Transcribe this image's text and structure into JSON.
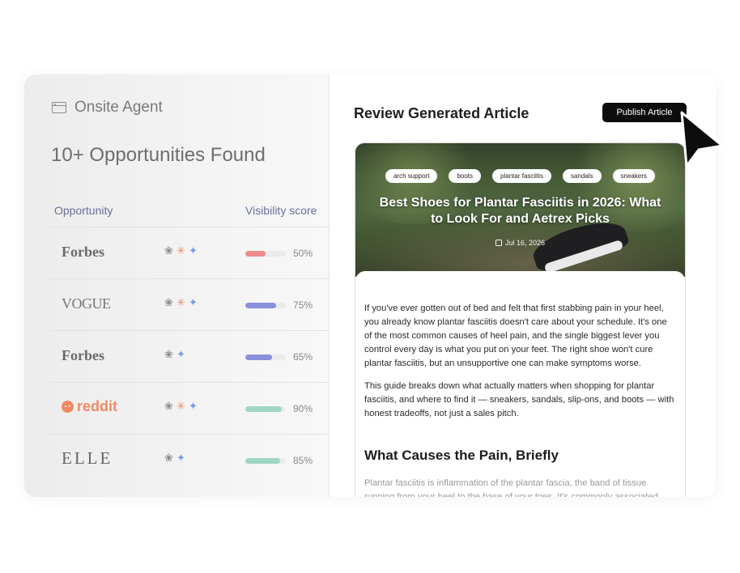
{
  "agent": {
    "label": "Onsite Agent",
    "icon": "browser-window-icon"
  },
  "opportunities": {
    "title": "10+ Opportunities Found",
    "columns": {
      "opportunity": "Opportunity",
      "score": "Visibility score"
    },
    "rows": [
      {
        "source": "Forbes",
        "models": [
          "chatgpt",
          "claude",
          "gemini"
        ],
        "score": 0.5,
        "score_label": "50%",
        "bar_color": "#ef8a8a"
      },
      {
        "source": "VOGUE",
        "models": [
          "chatgpt",
          "claude",
          "gemini"
        ],
        "score": 0.75,
        "score_label": "75%",
        "bar_color": "#8a90dc"
      },
      {
        "source": "Forbes",
        "models": [
          "chatgpt",
          "gemini"
        ],
        "score": 0.65,
        "score_label": "65%",
        "bar_color": "#8a90dc"
      },
      {
        "source": "reddit",
        "models": [
          "chatgpt",
          "claude",
          "gemini"
        ],
        "score": 0.9,
        "score_label": "90%",
        "bar_color": "#9fd6c2"
      },
      {
        "source": "ELLE",
        "models": [
          "chatgpt",
          "gemini"
        ],
        "score": 0.85,
        "score_label": "85%",
        "bar_color": "#9fd6c2"
      }
    ]
  },
  "review": {
    "title": "Review Generated Article",
    "publish_label": "Publish Article"
  },
  "article": {
    "tags": [
      "arch support",
      "boots",
      "plantar fasciitis",
      "sandals",
      "sneakers"
    ],
    "title": "Best Shoes for Plantar Fasciitis in 2026: What to Look For and Aetrex Picks",
    "date": "Jul 16, 2026",
    "p1": "If you've ever gotten out of bed and felt that first stabbing pain in your heel, you already know plantar fasciitis doesn't care about your schedule. It's one of the most common causes of heel pain, and the single biggest lever you control every day is what you put on your feet. The right shoe won't cure plantar fasciitis, but an unsupportive one can make symptoms worse.",
    "p2": "This guide breaks down what actually matters when shopping for plantar fasciitis, and where to find it — sneakers, sandals, slip-ons, and boots — with honest tradeoffs, not just a sales pitch.",
    "h2": "What Causes the Pain, Briefly",
    "p3": "Plantar fasciitis is inflammation of the plantar fascia, the band of tissue running from your heel to the base of your toes. It's commonly associated"
  }
}
